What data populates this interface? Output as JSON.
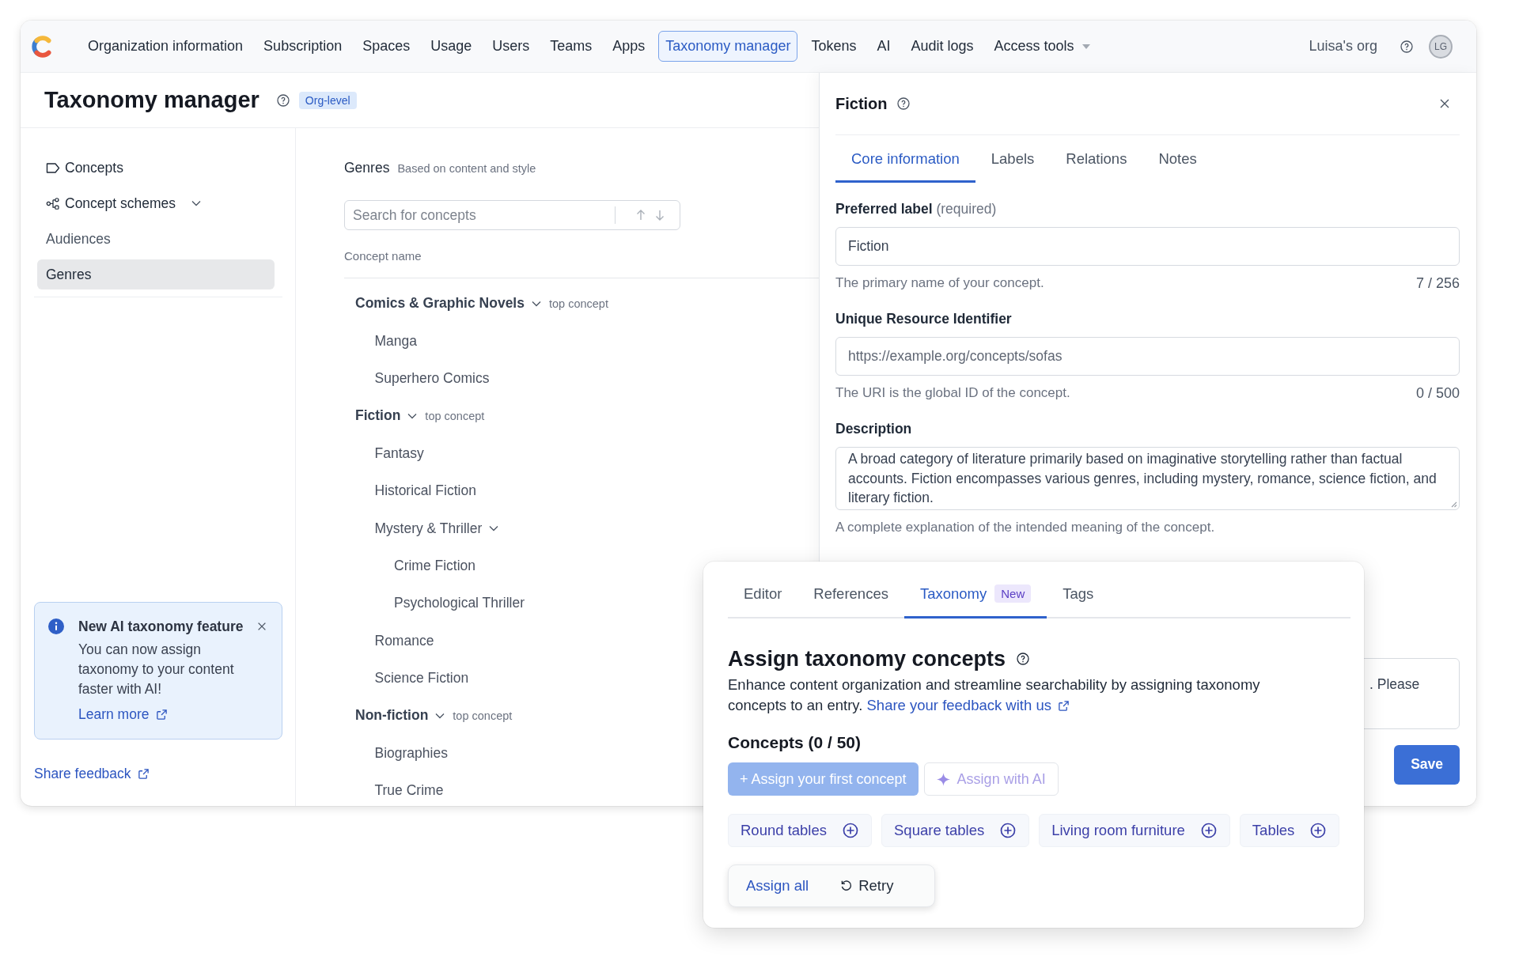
{
  "nav": {
    "items": [
      {
        "label": "Organization information",
        "kind": "link",
        "selected": false
      },
      {
        "label": "Subscription",
        "kind": "link",
        "selected": false
      },
      {
        "label": "Spaces",
        "kind": "link",
        "selected": false
      },
      {
        "label": "Usage",
        "kind": "link",
        "selected": false
      },
      {
        "label": "Users",
        "kind": "link",
        "selected": false
      },
      {
        "label": "Teams",
        "kind": "link",
        "selected": false
      },
      {
        "label": "Apps",
        "kind": "link",
        "selected": false
      },
      {
        "label": "Taxonomy manager",
        "kind": "link",
        "selected": true
      },
      {
        "label": "Tokens",
        "kind": "link",
        "selected": false
      },
      {
        "label": "AI",
        "kind": "link",
        "selected": false
      },
      {
        "label": "Audit logs",
        "kind": "link",
        "selected": false
      },
      {
        "label": "Access tools",
        "kind": "dropdown",
        "selected": false
      }
    ],
    "org": "Luisa's org",
    "avatar": "LG"
  },
  "header": {
    "title": "Taxonomy manager",
    "badge": "Org-level"
  },
  "sidebar": {
    "items": [
      {
        "label": "Concepts",
        "kind": "concepts",
        "selected": false
      },
      {
        "label": "Concept schemes",
        "kind": "schemes",
        "selected": false,
        "expanded": true,
        "children": [
          {
            "label": "Audiences",
            "selected": false
          },
          {
            "label": "Genres",
            "selected": true
          }
        ]
      }
    ]
  },
  "notice": {
    "title": "New AI taxonomy feature",
    "text": "You can now assign taxonomy to your content faster with AI!",
    "link": "Learn more"
  },
  "share_feedback": "Share feedback",
  "concepts": {
    "scheme": "Genres",
    "scheme_note": "Based on content and style",
    "search": {
      "placeholder": "Search for concepts"
    },
    "column": "Concept name",
    "tree": [
      {
        "label": "Comics & Graphic Novels",
        "tag": "top concept",
        "expanded": true,
        "children": [
          {
            "label": "Manga"
          },
          {
            "label": "Superhero Comics"
          }
        ]
      },
      {
        "label": "Fiction",
        "tag": "top concept",
        "expanded": true,
        "children": [
          {
            "label": "Fantasy"
          },
          {
            "label": "Historical Fiction"
          },
          {
            "label": "Mystery & Thriller",
            "expanded": true,
            "children": [
              {
                "label": "Crime Fiction"
              },
              {
                "label": "Psychological Thriller"
              }
            ]
          },
          {
            "label": "Romance"
          },
          {
            "label": "Science Fiction"
          }
        ]
      },
      {
        "label": "Non-fiction",
        "tag": "top concept",
        "expanded": true,
        "children": [
          {
            "label": "Biographies"
          },
          {
            "label": "True Crime"
          }
        ]
      }
    ]
  },
  "detail": {
    "title": "Fiction",
    "tabs": [
      {
        "label": "Core information",
        "selected": true
      },
      {
        "label": "Labels",
        "selected": false
      },
      {
        "label": "Relations",
        "selected": false
      },
      {
        "label": "Notes",
        "selected": false
      }
    ],
    "fields": [
      {
        "kind": "input",
        "label": "Preferred label",
        "note": "(required)",
        "value": "Fiction",
        "help": "The primary name of your concept.",
        "count": "7 / 256"
      },
      {
        "kind": "input",
        "label": "Unique Resource Identifier",
        "placeholder": "https://example.org/concepts/sofas",
        "help": "The URI is the global ID of the concept.",
        "count": "0 / 500"
      },
      {
        "kind": "textarea",
        "label": "Description",
        "value": "A broad category of literature primarily based on imaginative storytelling rather than factual accounts. Fiction encompasses various genres, including mystery, romance, science fiction, and literary fiction.",
        "help": "A complete explanation of the intended meaning of the concept."
      }
    ],
    "covered_field": {
      "value": ". Please"
    },
    "save": "Save"
  },
  "overlay": {
    "tabs": [
      {
        "label": "Editor",
        "selected": false
      },
      {
        "label": "References",
        "selected": false
      },
      {
        "label": "Taxonomy",
        "selected": true,
        "badge": "New"
      },
      {
        "label": "Tags",
        "selected": false
      }
    ],
    "title": "Assign taxonomy concepts",
    "description": "Enhance content organization and streamline searchability by assigning taxonomy concepts to an entry.",
    "feedback_link": "Share your feedback with us",
    "concepts_heading": "Concepts (0 / 50)",
    "assign_button": {
      "label": "+ Assign your first concept",
      "disabled": true
    },
    "ai_button": {
      "label": "Assign with AI",
      "disabled": true
    },
    "suggestions": [
      {
        "label": "Round tables"
      },
      {
        "label": "Square tables"
      },
      {
        "label": "Living room furniture"
      },
      {
        "label": "Tables"
      }
    ],
    "actions": [
      {
        "label": "Assign all",
        "kind": "link"
      },
      {
        "label": "Retry",
        "kind": "retry"
      }
    ]
  }
}
